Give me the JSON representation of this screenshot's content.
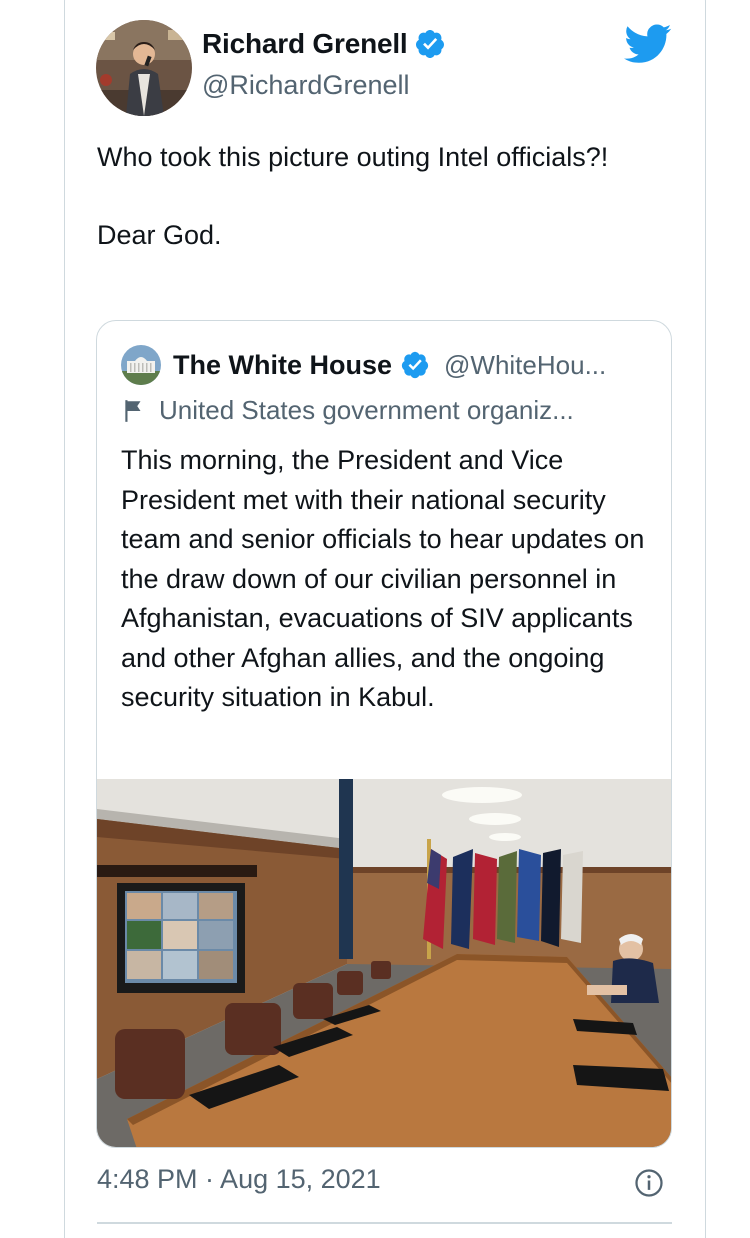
{
  "author": {
    "name": "Richard Grenell",
    "handle": "@RichardGrenell",
    "verified": true,
    "avatar_icon": "person-speaking-photo"
  },
  "tweet": {
    "text": "Who took this picture outing Intel officials?!\n\nDear God.",
    "timestamp": "4:48 PM · Aug 15, 2021"
  },
  "quoted_tweet": {
    "name": "The White House",
    "handle": "@WhiteHou...",
    "verified": true,
    "label": "United States government organiz...",
    "label_icon": "flag-icon",
    "text": "This morning, the President and Vice President met with their national security team and senior officials to hear updates on the draw down of our civilian personnel in Afghanistan, evacuations of SIV applicants and other Afghan allies, and the ongoing security situation in Kabul.",
    "media": "situation-room-photo"
  },
  "icons": {
    "brand": "twitter-bird-icon",
    "info": "info-icon"
  },
  "colors": {
    "twitter_blue": "#1d9bf0",
    "secondary_text": "#536471",
    "border": "#cfd9de"
  }
}
